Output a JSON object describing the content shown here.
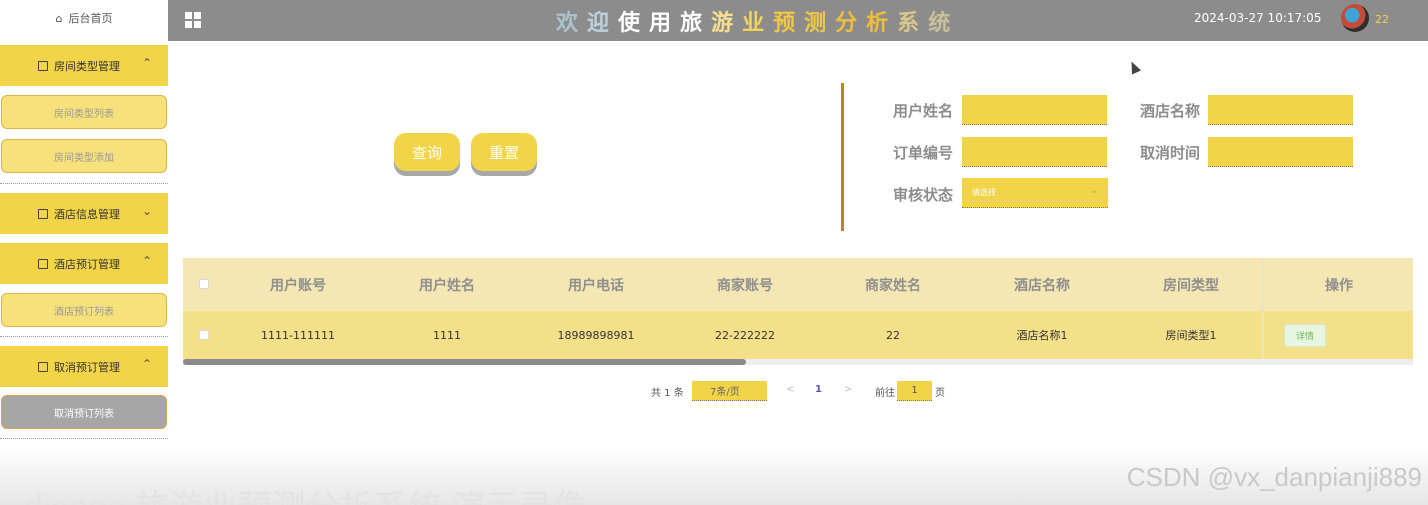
{
  "brand": {
    "icon": "home-icon",
    "label": "后台首页"
  },
  "header": {
    "title_chars": [
      {
        "ch": "欢",
        "color": "#a9c4cf"
      },
      {
        "ch": "迎",
        "color": "#bcd3dc"
      },
      {
        "ch": "使",
        "color": "#ffffff"
      },
      {
        "ch": "用",
        "color": "#ffffff"
      },
      {
        "ch": "旅",
        "color": "#ffffff"
      },
      {
        "ch": "游",
        "color": "#f8e08c"
      },
      {
        "ch": "业",
        "color": "#f4d45a"
      },
      {
        "ch": "预",
        "color": "#f2c642"
      },
      {
        "ch": "测",
        "color": "#f2c642"
      },
      {
        "ch": "分",
        "color": "#f0be3c"
      },
      {
        "ch": "析",
        "color": "#f0be3c"
      },
      {
        "ch": "系",
        "color": "#d9c88a"
      },
      {
        "ch": "统",
        "color": "#c8c19a"
      }
    ],
    "datetime": "2024-03-27 10:17:05",
    "username": "22"
  },
  "sidebar": {
    "groups": [
      {
        "label": "房间类型管理",
        "chevron": "^",
        "items": [
          "房间类型列表",
          "房间类型添加"
        ]
      },
      {
        "label": "酒店信息管理",
        "chevron": "v",
        "items": []
      },
      {
        "label": "酒店预订管理",
        "chevron": "^",
        "items": [
          "酒店预订列表"
        ]
      },
      {
        "label": "取消预订管理",
        "chevron": "^",
        "items": [
          "取消预订列表"
        ]
      }
    ]
  },
  "search": {
    "query_label": "查询",
    "reset_label": "重置",
    "fields": {
      "user_name": "用户姓名",
      "hotel_name": "酒店名称",
      "order_no": "订单编号",
      "cancel_time": "取消时间",
      "audit_status": "审核状态"
    },
    "audit_placeholder": "请选择"
  },
  "table": {
    "headers": [
      "用户账号",
      "用户姓名",
      "用户电话",
      "商家账号",
      "商家姓名",
      "酒店名称",
      "房间类型",
      "操作"
    ],
    "rows": [
      {
        "cells": [
          "1111-111111",
          "1111",
          "18989898981",
          "22-222222",
          "22",
          "酒店名称1",
          "房间类型1"
        ],
        "action": "详情"
      }
    ]
  },
  "pagination": {
    "total": "共 1 条",
    "page_size": "7条/页",
    "prev": "<",
    "current": "1",
    "next": ">",
    "goto": "前往",
    "goto_value": "1",
    "page_unit": "页"
  },
  "overlay": {
    "watermark": "CSDN @vx_danpianji889",
    "caption": "django 旅游业预测分析系统 演示录像"
  }
}
